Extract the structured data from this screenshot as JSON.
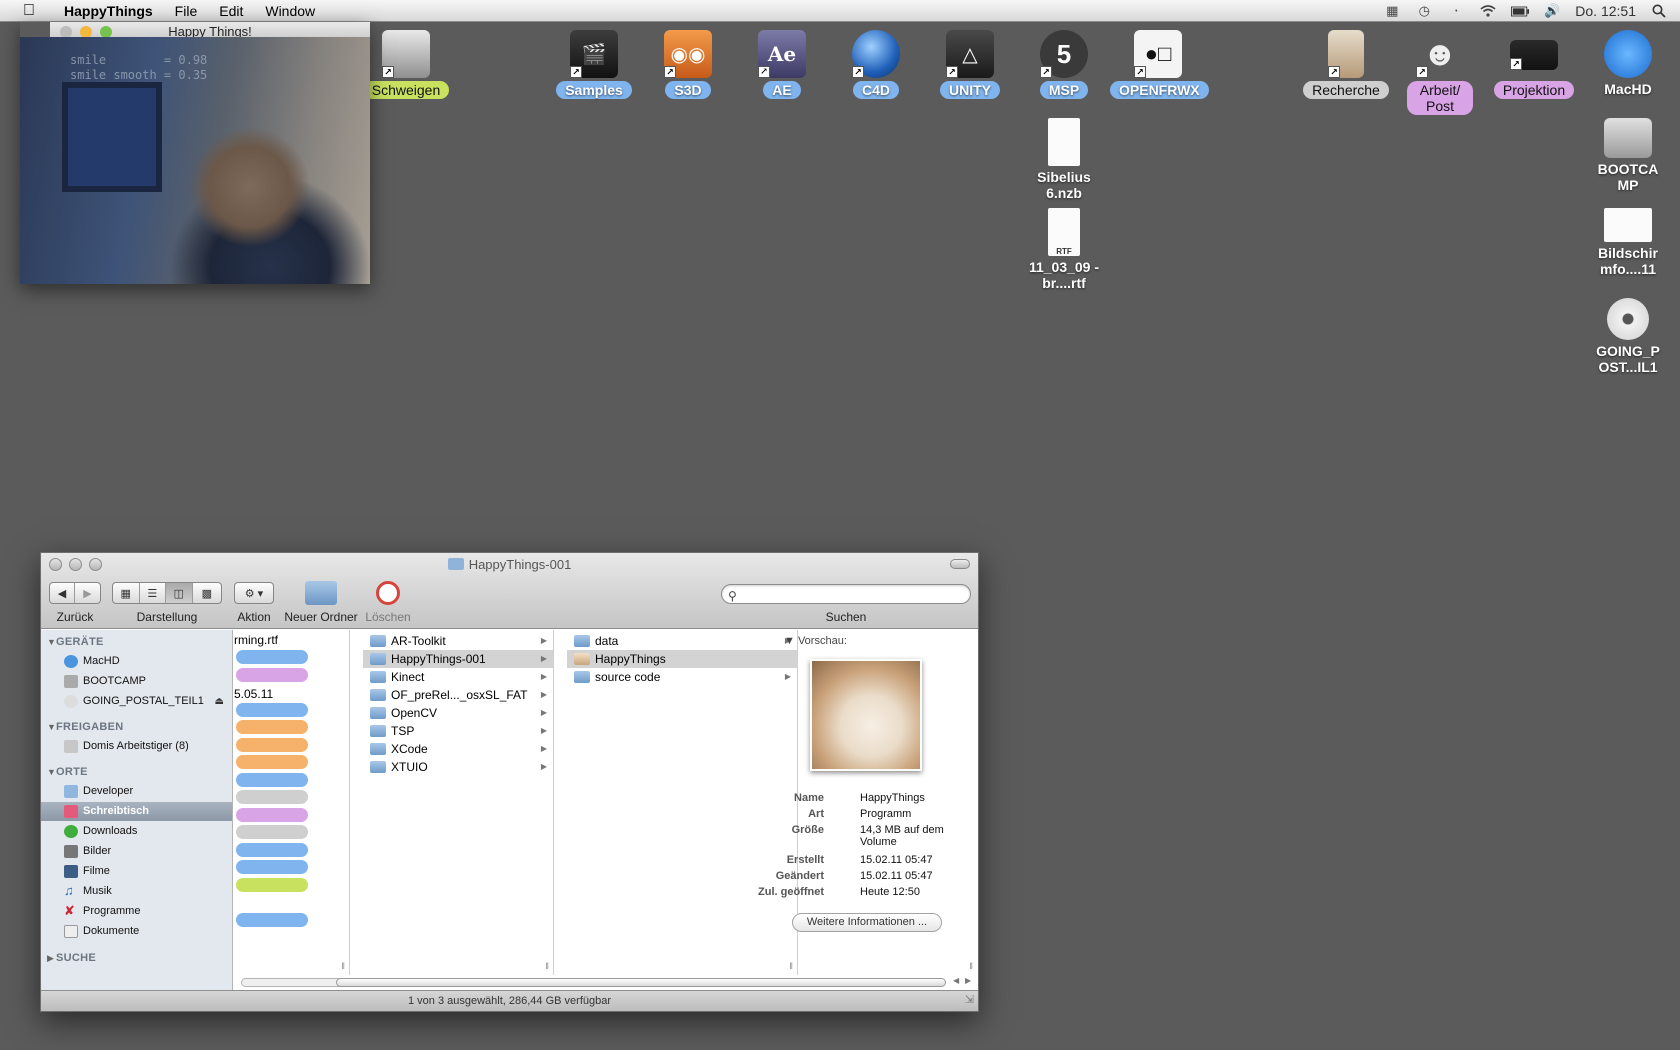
{
  "menubar": {
    "app_name": "HappyThings",
    "menus": [
      "File",
      "Edit",
      "Window"
    ],
    "clock": "Do. 12:51"
  },
  "desktop_icons": [
    {
      "label": "Schweigen",
      "tag": "green",
      "icon": "app-icon"
    },
    {
      "label": "Samples",
      "tag": "blue",
      "icon": "clapper-icon"
    },
    {
      "label": "S3D",
      "tag": "blue",
      "icon": "glasses-icon"
    },
    {
      "label": "AE",
      "tag": "blue",
      "icon": "after-effects-icon"
    },
    {
      "label": "C4D",
      "tag": "blue",
      "icon": "cinema4d-icon"
    },
    {
      "label": "UNITY",
      "tag": "blue",
      "icon": "unity-icon"
    },
    {
      "label": "MSP",
      "tag": "blue",
      "icon": "msp-icon"
    },
    {
      "label": "OPENFRWX",
      "tag": "blue",
      "icon": "openframeworks-icon"
    },
    {
      "label": "Recherche",
      "tag": "grey",
      "icon": "document-icon"
    },
    {
      "label": "Arbeit/ Post",
      "tag": "purple",
      "icon": "robot-icon"
    },
    {
      "label": "Projektion",
      "tag": "purple",
      "icon": "projector-icon"
    },
    {
      "label": "MacHD",
      "tag": "none",
      "icon": "disk-icon"
    },
    {
      "label": "Sibelius 6.nzb",
      "tag": "none",
      "icon": "file-icon"
    },
    {
      "label": "11_03_09 -br....rtf",
      "tag": "none",
      "icon": "rtf-file-icon"
    },
    {
      "label": "BOOTCA MP",
      "tag": "none",
      "icon": "hard-drive-icon"
    },
    {
      "label": "Bildschir mfo....11",
      "tag": "none",
      "icon": "screenshot-file-icon"
    },
    {
      "label": "GOING_P OST...IL1",
      "tag": "none",
      "icon": "dvd-icon"
    }
  ],
  "happy_window": {
    "title": "Happy Things!",
    "smile_line": "smile        = 0.98",
    "smile_smooth_line": "smile smooth = 0.35"
  },
  "finder": {
    "title": "HappyThings-001",
    "toolbar": {
      "back_label": "Zurück",
      "view_label": "Darstellung",
      "action_label": "Aktion",
      "new_folder_label": "Neuer Ordner",
      "delete_label": "Löschen",
      "search_label": "Suchen",
      "search_placeholder": ""
    },
    "sidebar": {
      "devices_header": "GERÄTE",
      "devices": [
        {
          "label": "MacHD",
          "icon": "disk-icon"
        },
        {
          "label": "BOOTCAMP",
          "icon": "hard-drive-icon"
        },
        {
          "label": "GOING_POSTAL_TEIL1",
          "icon": "dvd-icon"
        }
      ],
      "shared_header": "FREIGABEN",
      "shared": [
        {
          "label": "Domis Arbeitstiger (8)",
          "icon": "computer-icon"
        }
      ],
      "places_header": "ORTE",
      "places": [
        {
          "label": "Developer",
          "icon": "folder-icon"
        },
        {
          "label": "Schreibtisch",
          "icon": "desktop-icon"
        },
        {
          "label": "Downloads",
          "icon": "downloads-icon"
        },
        {
          "label": "Bilder",
          "icon": "pictures-icon"
        },
        {
          "label": "Filme",
          "icon": "movies-icon"
        },
        {
          "label": "Musik",
          "icon": "music-icon"
        },
        {
          "label": "Programme",
          "icon": "applications-icon"
        },
        {
          "label": "Dokumente",
          "icon": "documents-icon"
        }
      ],
      "search_header": "SUCHE"
    },
    "col1": {
      "visible_texts": [
        "rming.rtf",
        "5.05.11"
      ],
      "tags": [
        "blue",
        "purple",
        "none",
        "blue",
        "orange",
        "orange",
        "orange",
        "blue",
        "grey",
        "purple",
        "grey",
        "blue",
        "blue",
        "green",
        "none",
        "blue"
      ]
    },
    "col2": [
      "AR-Toolkit",
      "HappyThings-001",
      "Kinect",
      "OF_preRel..._osxSL_FAT",
      "OpenCV",
      "TSP",
      "XCode",
      "XTUIO"
    ],
    "col3": [
      {
        "label": "data",
        "type": "folder"
      },
      {
        "label": "HappyThings",
        "type": "app"
      },
      {
        "label": "source code",
        "type": "folder"
      }
    ],
    "preview": {
      "header": "Vorschau:",
      "fields": [
        {
          "key": "Name",
          "value": "HappyThings"
        },
        {
          "key": "Art",
          "value": "Programm"
        },
        {
          "key": "Größe",
          "value": "14,3 MB auf dem Volume"
        },
        {
          "key": "Erstellt",
          "value": "15.02.11 05:47"
        },
        {
          "key": "Geändert",
          "value": "15.02.11 05:47"
        },
        {
          "key": "Zul. geöffnet",
          "value": "Heute 12:50"
        }
      ],
      "more_button": "Weitere Informationen ..."
    },
    "status": "1 von 3 ausgewählt, 286,44 GB verfügbar"
  }
}
